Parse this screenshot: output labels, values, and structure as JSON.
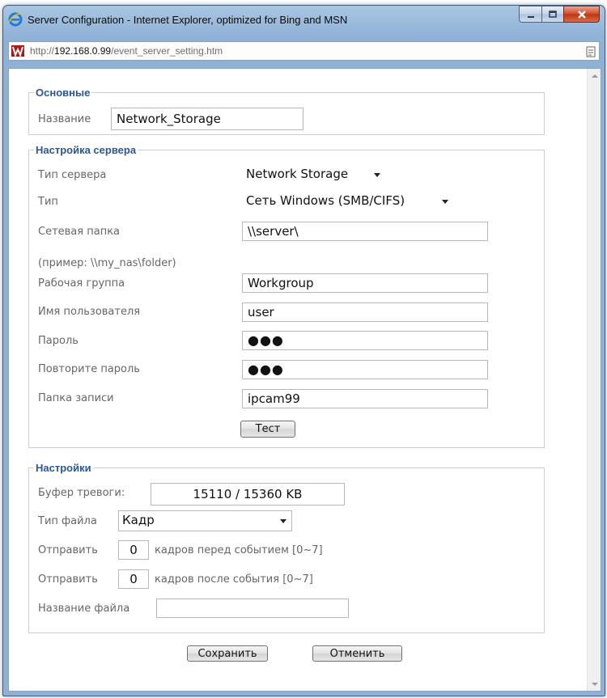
{
  "window": {
    "title": "Server Configuration - Internet Explorer, optimized for Bing and MSN",
    "url_proto": "http://",
    "url_host": "192.168.0.99",
    "url_path": "/event_server_setting.htm"
  },
  "basic": {
    "legend": "Основные",
    "name_label": "Название",
    "name_value": "Network_Storage"
  },
  "server": {
    "legend": "Настройка сервера",
    "server_type_label": "Тип сервера",
    "server_type_value": "Network Storage",
    "type_label": "Тип",
    "type_value": "Сеть Windows (SMB/CIFS)",
    "folder_label": "Сетевая папка",
    "folder_value": "\\\\server\\",
    "folder_example": "(пример: \\\\my_nas\\folder)",
    "workgroup_label": "Рабочая группа",
    "workgroup_value": "Workgroup",
    "username_label": "Имя пользователя",
    "username_value": "user",
    "password_label": "Пароль",
    "password_value": "●●●",
    "password2_label": "Повторите пароль",
    "password2_value": "●●●",
    "record_folder_label": "Папка записи",
    "record_folder_value": "ipcam99",
    "test_button": "Тест"
  },
  "settings": {
    "legend": "Настройки",
    "buffer_label": "Буфер тревоги:",
    "buffer_value": "15110 / 15360 KB",
    "file_type_label": "Тип файла",
    "file_type_value": "Кадр",
    "send_label_1": "Отправить",
    "frames_before_value": "0",
    "frames_before_text": "кадров перед событием [0~7]",
    "send_label_2": "Отправить",
    "frames_after_value": "0",
    "frames_after_text": "кадров после события [0~7]",
    "filename_label": "Название файла",
    "filename_value": ""
  },
  "actions": {
    "save": "Сохранить",
    "cancel": "Отменить"
  }
}
